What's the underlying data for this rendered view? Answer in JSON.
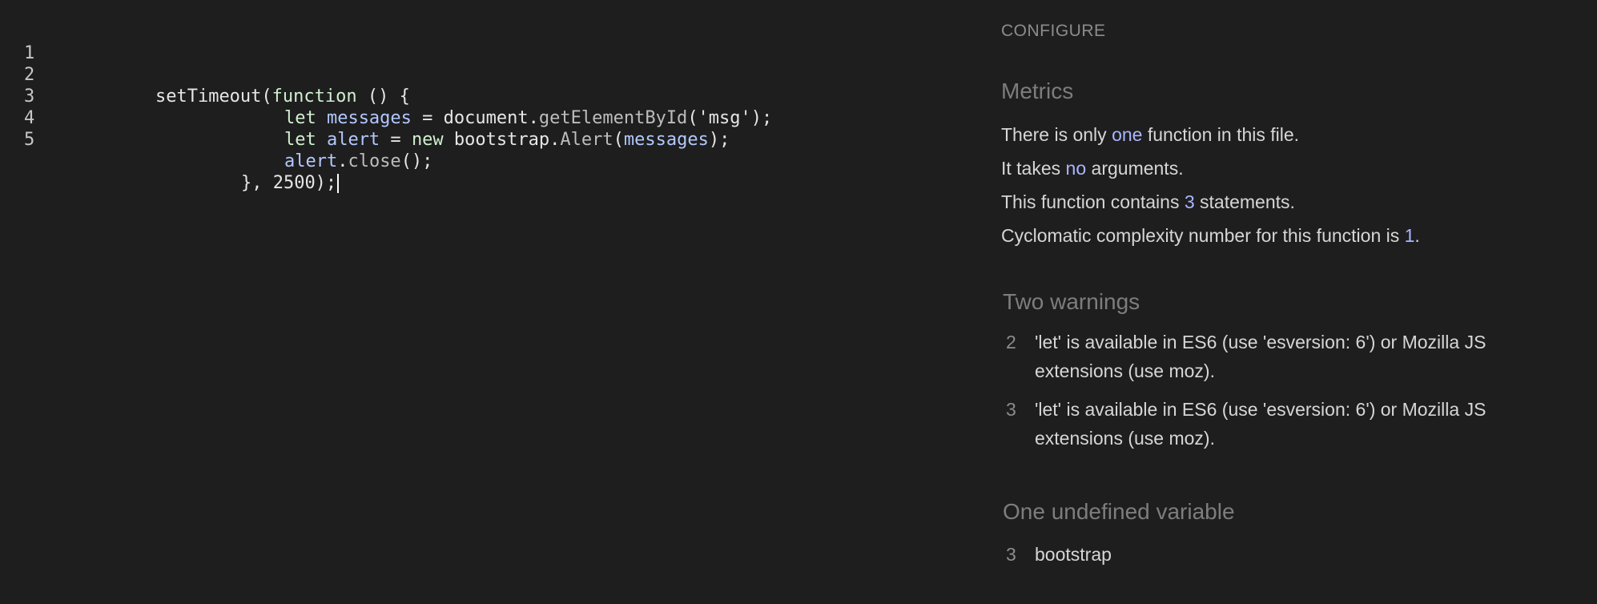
{
  "editor": {
    "lines": [
      {
        "number": "1",
        "tokens": [
          {
            "text": "setTimeout(",
            "kind": "plain"
          },
          {
            "text": "function",
            "kind": "kw"
          },
          {
            "text": " () {",
            "kind": "plain"
          }
        ]
      },
      {
        "number": "2",
        "tokens": [
          {
            "text": "let ",
            "kind": "kw"
          },
          {
            "text": "messages",
            "kind": "var"
          },
          {
            "text": " = document.",
            "kind": "plain"
          },
          {
            "text": "getElementById",
            "kind": "fn"
          },
          {
            "text": "('msg');",
            "kind": "plain"
          }
        ]
      },
      {
        "number": "3",
        "tokens": [
          {
            "text": "let ",
            "kind": "kw"
          },
          {
            "text": "alert",
            "kind": "var"
          },
          {
            "text": " = ",
            "kind": "plain"
          },
          {
            "text": "new",
            "kind": "kw"
          },
          {
            "text": " bootstrap.",
            "kind": "plain"
          },
          {
            "text": "Alert",
            "kind": "fn"
          },
          {
            "text": "(",
            "kind": "plain"
          },
          {
            "text": "messages",
            "kind": "var"
          },
          {
            "text": ");",
            "kind": "plain"
          }
        ]
      },
      {
        "number": "4",
        "tokens": [
          {
            "text": "alert",
            "kind": "var"
          },
          {
            "text": ".",
            "kind": "plain"
          },
          {
            "text": "close",
            "kind": "fn"
          },
          {
            "text": "();",
            "kind": "plain"
          }
        ]
      },
      {
        "number": "5",
        "tokens": [
          {
            "text": "}, 2500);",
            "kind": "plain"
          }
        ]
      }
    ]
  },
  "report": {
    "configure_label": "CONFIGURE",
    "metrics": {
      "title": "Metrics",
      "line1": {
        "pre": "There is only ",
        "hl": "one",
        "post": " function in this file."
      },
      "line2": {
        "pre": "It takes ",
        "hl": "no",
        "post": " arguments."
      },
      "line3": {
        "pre": "This function contains ",
        "hl": "3",
        "post": " statements."
      },
      "line4": {
        "pre": "Cyclomatic complexity number for this function is ",
        "hl": "1",
        "post": "."
      }
    },
    "warnings": {
      "title": "Two warnings",
      "items": [
        {
          "line": "2",
          "text": "'let' is available in ES6 (use 'esversion: 6') or Mozilla JS extensions (use moz)."
        },
        {
          "line": "3",
          "text": "'let' is available in ES6 (use 'esversion: 6') or Mozilla JS extensions (use moz)."
        }
      ]
    },
    "undefined": {
      "title": "One undefined variable",
      "items": [
        {
          "line": "3",
          "text": "bootstrap"
        }
      ]
    }
  },
  "colors": {
    "background": "#1e1e1e",
    "highlight": "#aab6ff",
    "keyword": "#d0f0d0",
    "variable": "#b3c8ff",
    "muted": "#7d7d7d"
  }
}
